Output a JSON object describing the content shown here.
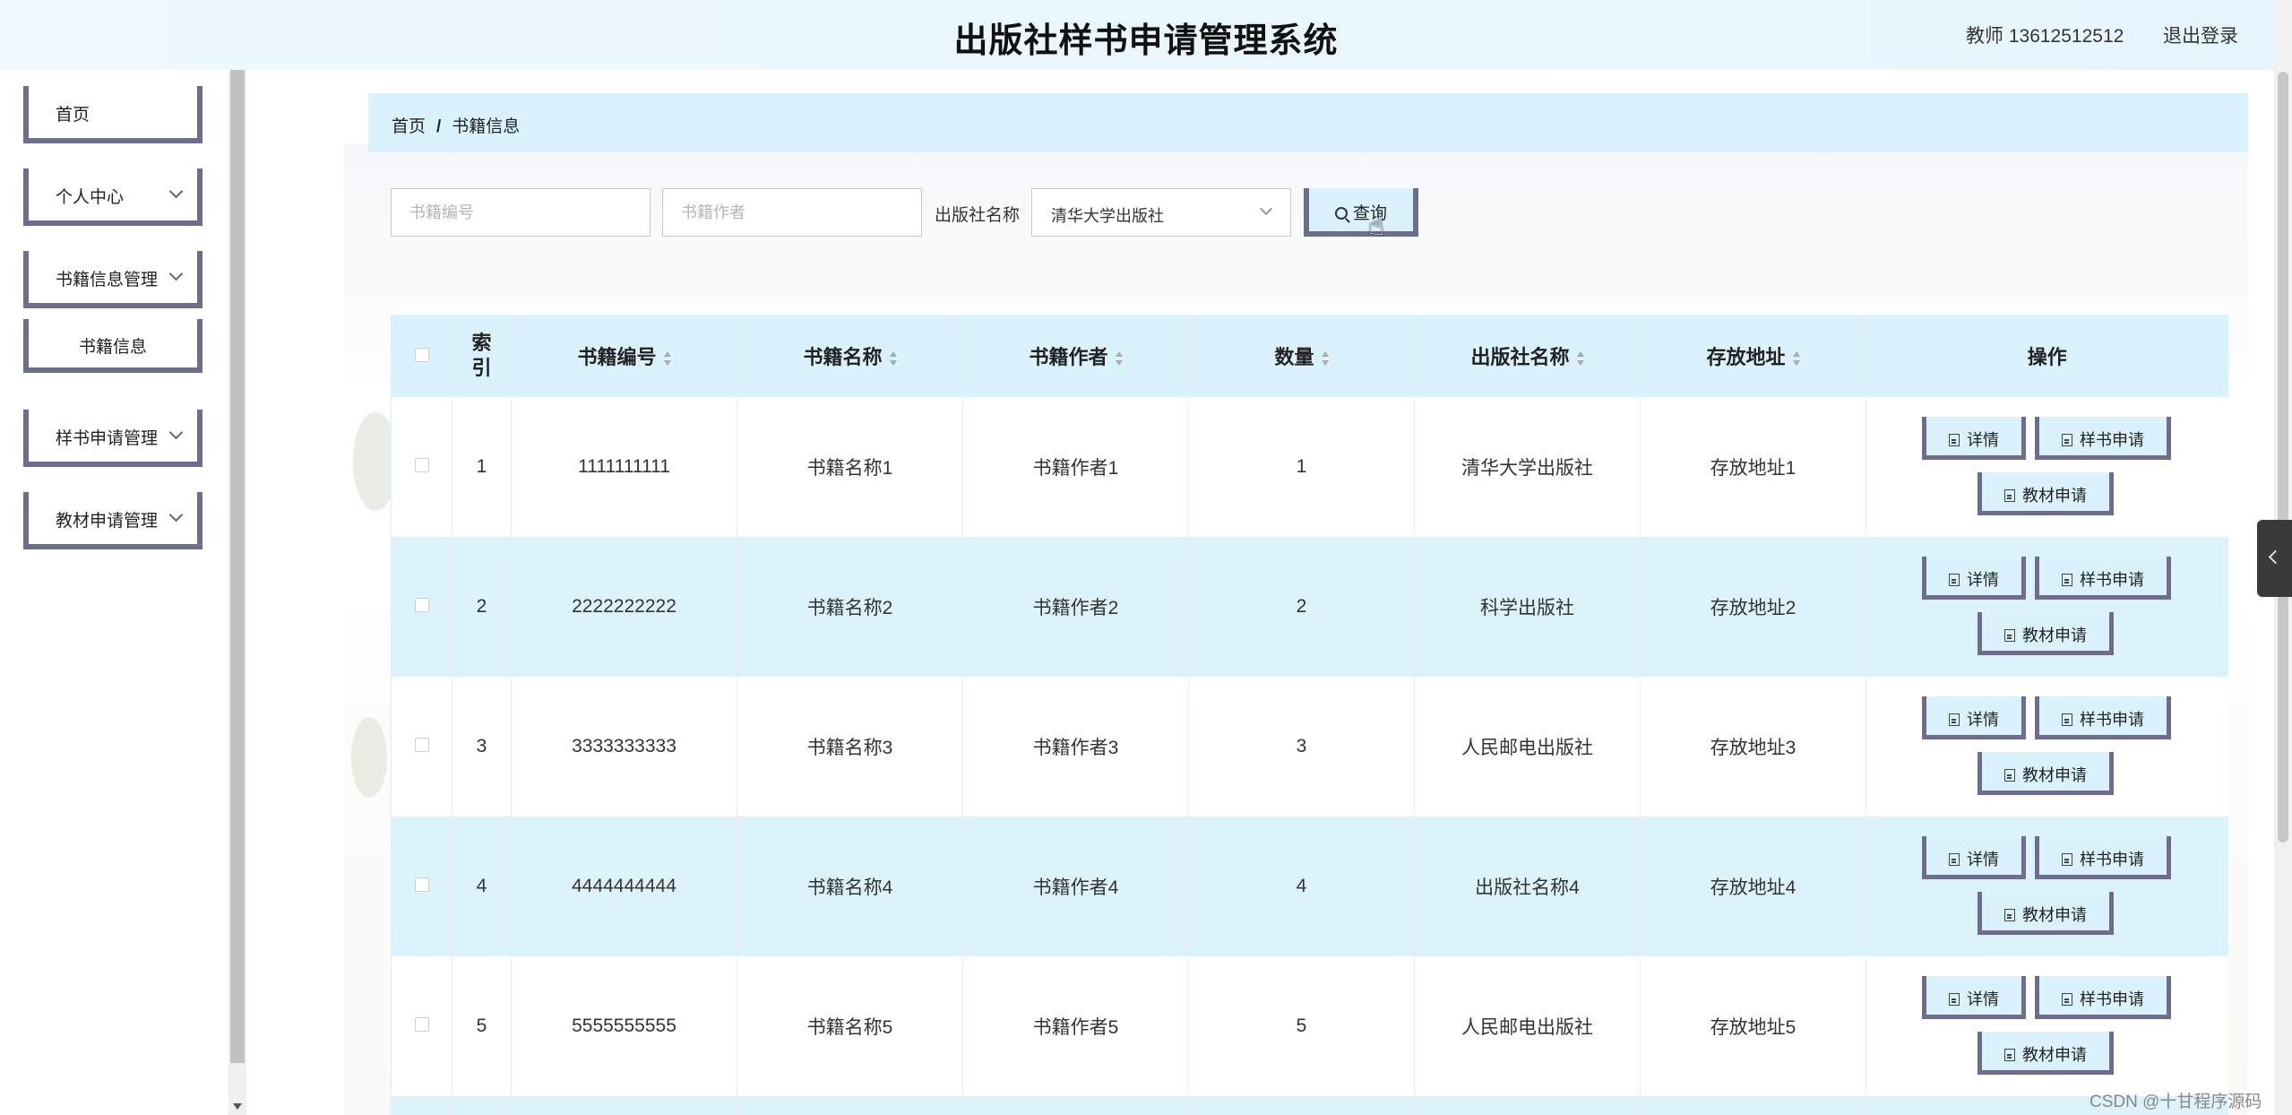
{
  "header": {
    "title": "出版社样书申请管理系统",
    "user": "教师 13612512512",
    "logout": "退出登录"
  },
  "sidebar": {
    "items": [
      {
        "label": "首页"
      },
      {
        "label": "个人中心"
      },
      {
        "label": "书籍信息管理"
      },
      {
        "label": "书籍信息"
      },
      {
        "label": "样书申请管理"
      },
      {
        "label": "教材申请管理"
      }
    ]
  },
  "breadcrumb": {
    "home": "首页",
    "separator": "/",
    "current": "书籍信息"
  },
  "search": {
    "code_placeholder": "书籍编号",
    "author_placeholder": "书籍作者",
    "publisher_label": "出版社名称",
    "publisher_value": "清华大学出版社",
    "query_label": "查询"
  },
  "table": {
    "headers": {
      "index": "索引",
      "code": "书籍编号",
      "name": "书籍名称",
      "author": "书籍作者",
      "qty": "数量",
      "publisher": "出版社名称",
      "location": "存放地址",
      "ops": "操作"
    },
    "actions": {
      "detail": "详情",
      "sample": "样书申请",
      "material": "教材申请"
    },
    "rows": [
      {
        "index": "1",
        "code": "1111111111",
        "name": "书籍名称1",
        "author": "书籍作者1",
        "qty": "1",
        "publisher": "清华大学出版社",
        "location": "存放地址1"
      },
      {
        "index": "2",
        "code": "2222222222",
        "name": "书籍名称2",
        "author": "书籍作者2",
        "qty": "2",
        "publisher": "科学出版社",
        "location": "存放地址2"
      },
      {
        "index": "3",
        "code": "3333333333",
        "name": "书籍名称3",
        "author": "书籍作者3",
        "qty": "3",
        "publisher": "人民邮电出版社",
        "location": "存放地址3"
      },
      {
        "index": "4",
        "code": "4444444444",
        "name": "书籍名称4",
        "author": "书籍作者4",
        "qty": "4",
        "publisher": "出版社名称4",
        "location": "存放地址4"
      },
      {
        "index": "5",
        "code": "5555555555",
        "name": "书籍名称5",
        "author": "书籍作者5",
        "qty": "5",
        "publisher": "人民邮电出版社",
        "location": "存放地址5"
      }
    ]
  },
  "watermark": "CSDN @十甘程序源码"
}
